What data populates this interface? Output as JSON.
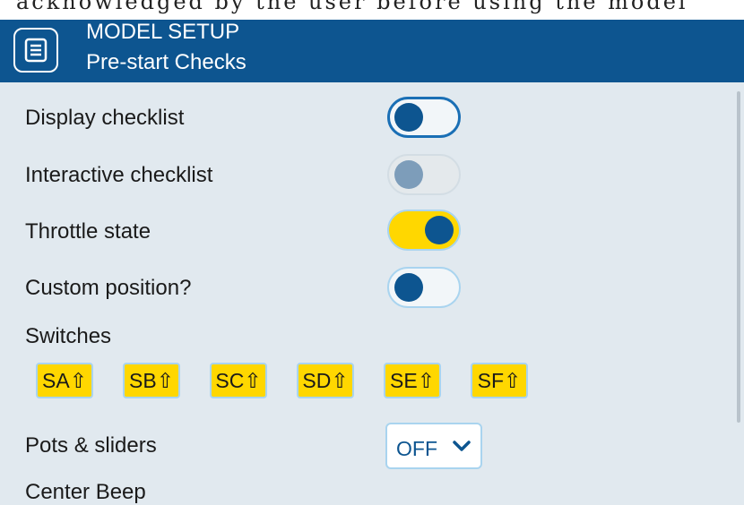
{
  "top_strip_text": "acknowledged by the user before using the model",
  "header": {
    "title": "MODEL SETUP",
    "subtitle": "Pre-start Checks"
  },
  "rows": {
    "display_checklist": {
      "label": "Display checklist",
      "state": "off",
      "focused": true
    },
    "interactive_checklist": {
      "label": "Interactive checklist",
      "state": "off",
      "disabled": true
    },
    "throttle_state": {
      "label": "Throttle state",
      "state": "on"
    },
    "custom_position": {
      "label": "Custom position?",
      "state": "off"
    },
    "switches": {
      "label": "Switches",
      "items": [
        "SA⇧",
        "SB⇧",
        "SC⇧",
        "SD⇧",
        "SE⇧",
        "SF⇧"
      ]
    },
    "pots_sliders": {
      "label": "Pots & sliders",
      "value": "OFF"
    },
    "center_beep": {
      "label": "Center Beep"
    }
  },
  "colors": {
    "header_bg": "#0d5590",
    "background": "#e1e9ef",
    "accent_yellow": "#ffd700",
    "knob": "#0d5590"
  },
  "icons": {
    "menu": "menu-list-icon",
    "dropdown": "chevron-down-icon"
  }
}
